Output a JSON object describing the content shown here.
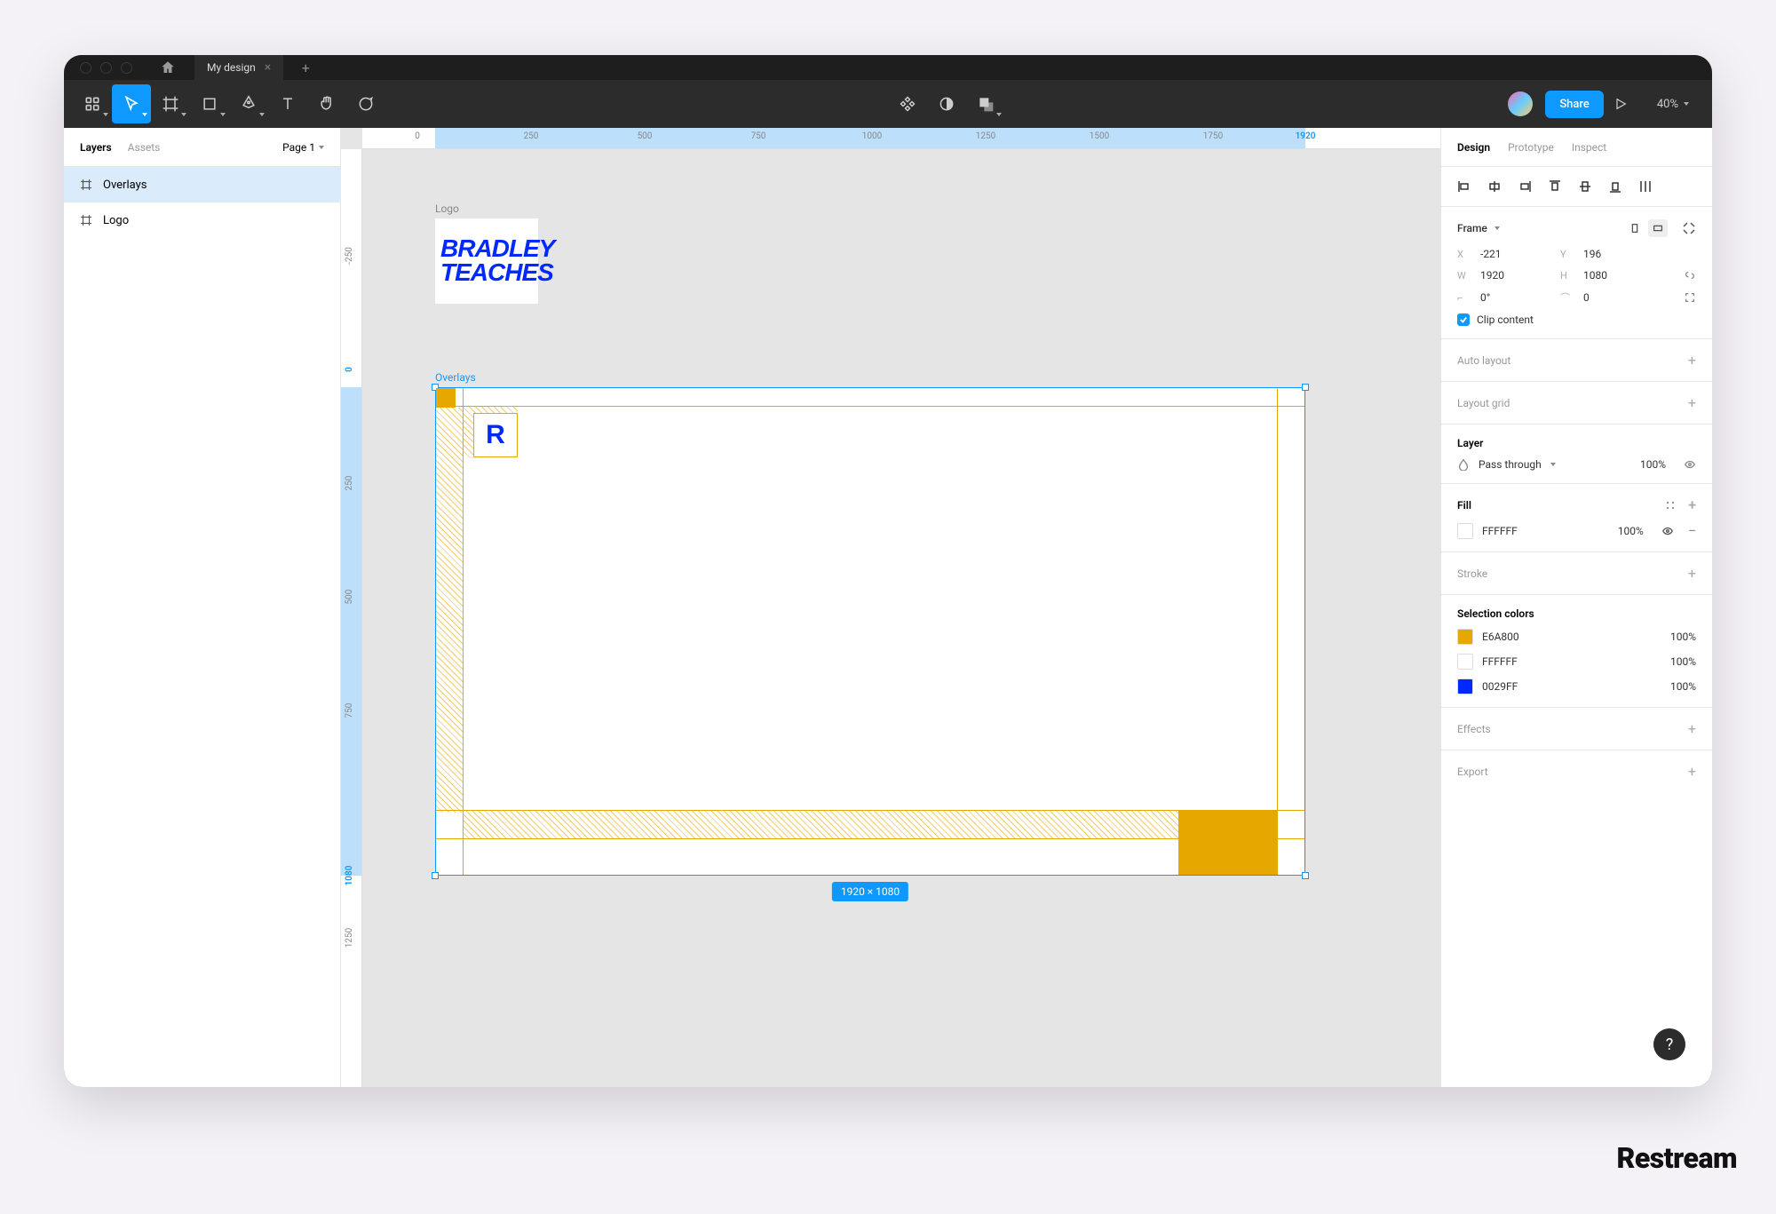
{
  "tab": {
    "title": "My design"
  },
  "toolbar": {
    "share": "Share",
    "zoom": "40%"
  },
  "leftPanel": {
    "layersTab": "Layers",
    "assetsTab": "Assets",
    "page": "Page 1",
    "items": [
      "Overlays",
      "Logo"
    ]
  },
  "canvas": {
    "logoLabel": "Logo",
    "logoLine1": "BRADLEY",
    "logoLine2": "TEACHES",
    "overlaysLabel": "Overlays",
    "rLetter": "R",
    "dimensions": "1920 × 1080",
    "hTicks": [
      "0",
      "250",
      "500",
      "750",
      "1000",
      "1250",
      "1500",
      "1750",
      "1920"
    ],
    "vTicks": [
      "-250",
      "0",
      "250",
      "500",
      "750",
      "1080",
      "1250"
    ]
  },
  "rightPanel": {
    "tabs": [
      "Design",
      "Prototype",
      "Inspect"
    ],
    "frame": {
      "label": "Frame",
      "x": "-221",
      "y": "196",
      "w": "1920",
      "h": "1080",
      "rotation": "0°",
      "radius": "0",
      "clipContent": "Clip content"
    },
    "autoLayout": "Auto layout",
    "layoutGrid": "Layout grid",
    "layer": {
      "label": "Layer",
      "blend": "Pass through",
      "opacity": "100%"
    },
    "fill": {
      "label": "Fill",
      "color": "FFFFFF",
      "opacity": "100%"
    },
    "stroke": "Stroke",
    "selectionColors": {
      "label": "Selection colors",
      "items": [
        {
          "hex": "E6A800",
          "opacity": "100%",
          "swatch": "#e6a800"
        },
        {
          "hex": "FFFFFF",
          "opacity": "100%",
          "swatch": "#ffffff"
        },
        {
          "hex": "0029FF",
          "opacity": "100%",
          "swatch": "#0029ff"
        }
      ]
    },
    "effects": "Effects",
    "export": "Export"
  },
  "watermark": "Restream"
}
